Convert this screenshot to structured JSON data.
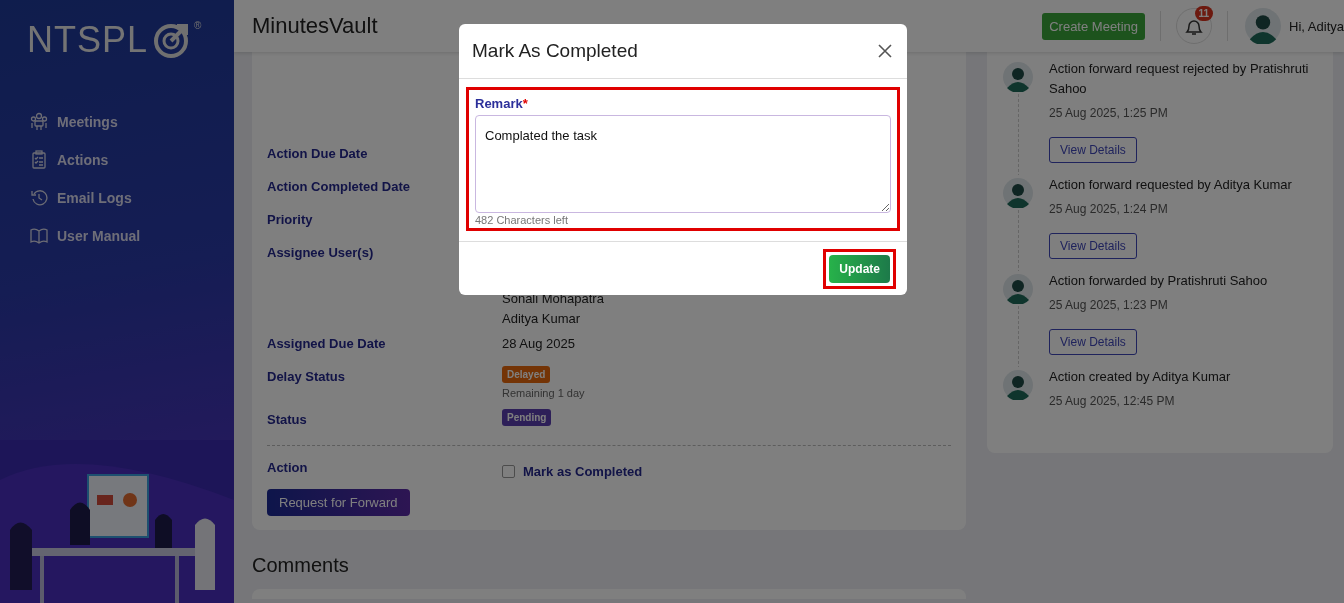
{
  "sidebar": {
    "logo": "NTSPL",
    "logo_mark": "®",
    "items": [
      {
        "label": "Meetings"
      },
      {
        "label": "Actions"
      },
      {
        "label": "Email Logs"
      },
      {
        "label": "User Manual"
      }
    ]
  },
  "header": {
    "title": "MinutesVault",
    "create_button": "Create Meeting",
    "notification_count": "11",
    "greeting": "Hi, Aditya"
  },
  "details": {
    "rows": [
      {
        "label": "Action Due Date"
      },
      {
        "label": "Action Completed Date"
      },
      {
        "label": "Priority"
      },
      {
        "label": "Assignee User(s)",
        "values": [
          "Sonali Mohapatra",
          "Aditya Kumar"
        ]
      },
      {
        "label": "Assigned Due Date",
        "values": [
          "28 Aug 2025"
        ]
      },
      {
        "label": "Delay Status",
        "badge": {
          "text": "Delayed",
          "kind": "warning"
        },
        "note": "Remaining 1 day"
      },
      {
        "label": "Status",
        "badge": {
          "text": "Pending",
          "kind": "pending"
        }
      }
    ],
    "action": {
      "label": "Action",
      "checkbox_label": "Mark as Completed",
      "checked": false
    },
    "forward_button": "Request for Forward"
  },
  "comments_title": "Comments",
  "timeline": [
    {
      "text": "Action forward request rejected by Pratishruti Sahoo",
      "time": "25 Aug 2025, 1:25 PM",
      "button": "View Details"
    },
    {
      "text": "Action forward requested by Aditya Kumar",
      "time": "25 Aug 2025, 1:24 PM",
      "button": "View Details"
    },
    {
      "text": "Action forwarded by Pratishruti Sahoo",
      "time": "25 Aug 2025, 1:23 PM",
      "button": "View Details"
    },
    {
      "text": "Action created by Aditya Kumar",
      "time": "25 Aug 2025, 12:45 PM"
    }
  ],
  "modal": {
    "title": "Mark As Completed",
    "field_label": "Remark",
    "required_mark": "*",
    "value": "Complated the task",
    "counter": "482 Characters left",
    "field_highlighted": true,
    "button": "Update",
    "button_highlighted": true
  }
}
